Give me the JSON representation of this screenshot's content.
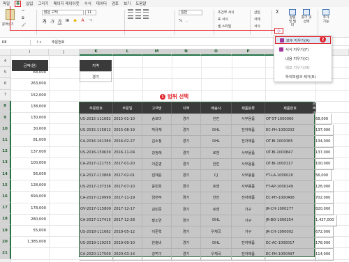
{
  "menu": {
    "items": [
      "파일",
      "홈",
      "삽입",
      "그리기",
      "페이지 레이아웃",
      "수식",
      "데이터",
      "검토",
      "보기",
      "도움말"
    ],
    "active_index": 1
  },
  "ribbon": {
    "paste_label": "붙여넣기",
    "font_name": "맑은 고딕",
    "font_size": "11",
    "number_format": "일반",
    "number_row": "% ,",
    "cond_format": "조건부 서식",
    "table_format": "표 서식",
    "cell_style": "셀 스타일",
    "insert": "삽입",
    "delete": "삭제",
    "format": "서식",
    "sort_filter": "정렬 및 필터",
    "find_select": "찾기 및 선택",
    "addins": "추가 기능"
  },
  "clear_menu": {
    "items": [
      "모두 지우기(A)",
      "서식 지우기(F)",
      "내용 지우기(C)",
      "메모 지우기(M)",
      "하이퍼링크 제거(R)"
    ],
    "badge": "2"
  },
  "formula_bar": {
    "name_box": "K8",
    "fx": "fx",
    "content": "주문번호"
  },
  "columns": [
    "I",
    "J",
    "K",
    "L",
    "M",
    "N",
    "O",
    "P",
    "Q"
  ],
  "row_numbers": [
    "4",
    "5",
    "6",
    "7",
    "8",
    "9",
    "10",
    "11",
    "12",
    "13",
    "14",
    "15",
    "16",
    "17",
    "18",
    "19",
    "20",
    "21",
    "22"
  ],
  "column_i": {
    "header": "금액(원)",
    "values": [
      "68,000",
      "263,000",
      "152,000",
      "138,000",
      "130,000",
      "30,000",
      "81,000",
      "137,000",
      "100,000",
      "56,000",
      "128,000",
      "694,000",
      "178,000",
      "280,000",
      "55,000",
      "1,385,000"
    ]
  },
  "region_box": {
    "header": "지역",
    "value": "경기"
  },
  "annotation": {
    "number": "1",
    "text": "범위 선택"
  },
  "table": {
    "headers": [
      "주문번호",
      "주문일",
      "고객명",
      "지역",
      "배송사",
      "제품분류",
      "제품번호",
      "금액(원)"
    ],
    "rows": [
      [
        "US-2015-111682",
        "2015-01-10",
        "송보미",
        "경기",
        "한진",
        "사무용품",
        "OT-ST-1000060",
        "68,000"
      ],
      [
        "US-2015-115812",
        "2015-08-19",
        "박유재",
        "경기",
        "DHL",
        "전자제품",
        "EC-PH-1000202",
        "137,000"
      ],
      [
        "CA-2016-161389",
        "2016-02-27",
        "김소정",
        "경기",
        "DHL",
        "전자제품",
        "OT-BI-1000365",
        "134,000"
      ],
      [
        "US-2016-150630",
        "2016-11-04",
        "강정애",
        "경기",
        "로젠",
        "사무용품",
        "OT-BI-1000847",
        "137,000"
      ],
      [
        "CA-2017-121755",
        "2017-01-20",
        "이준영",
        "경기",
        "한진",
        "사무용품",
        "OT-BI-1000117",
        "100,000"
      ],
      [
        "CA-2017-113868",
        "2017-02-01",
        "엄재윤",
        "경기",
        "CJ",
        "사무용품",
        "FT-LA-1000020",
        "56,000"
      ],
      [
        "US-2017-137336",
        "2017-07-10",
        "윤빈희",
        "경기",
        "로젠",
        "사무용품",
        "FT-AP-1000149",
        "128,000"
      ],
      [
        "CA-2017-120999",
        "2017-11-19",
        "임현주",
        "경기",
        "한진",
        "전자제품",
        "EC-PH-1000406",
        "702,000"
      ],
      [
        "OV-2017-115809",
        "2017-12-17",
        "김민준",
        "경기",
        "로젠",
        "가구",
        "JR-CH-1000277",
        "820,000"
      ],
      [
        "CA-2017-117415",
        "2017-12-28",
        "황소연",
        "경기",
        "DHL",
        "가구",
        "JR-BO-1000254",
        "1,427,000"
      ],
      [
        "US-2018-111682",
        "2018-05-12",
        "이준혁",
        "경기",
        "우체국",
        "가구",
        "JR-CH-1000002",
        "672,000"
      ],
      [
        "US-2019-119255",
        "2019-09-10",
        "한솔비",
        "경기",
        "DHL",
        "전자제품",
        "EC-AC-1000017",
        "178,000"
      ],
      [
        "CA-2020-117509",
        "2020-03-14",
        "강먹구",
        "경기",
        "우체국",
        "전자제품",
        "EC-PH-1000497",
        "114,000"
      ]
    ]
  }
}
